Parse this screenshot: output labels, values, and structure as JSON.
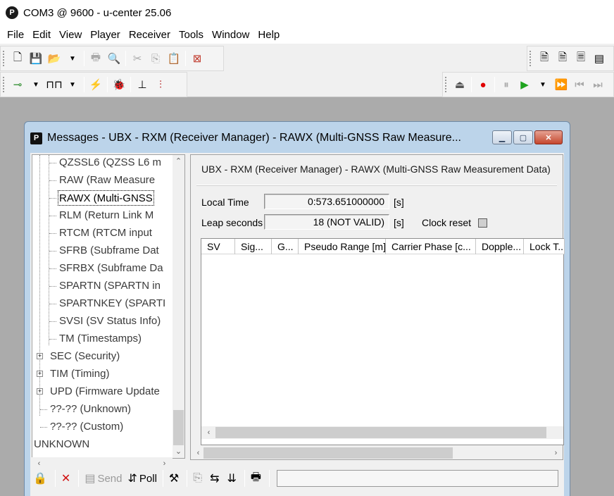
{
  "window": {
    "title": "COM3 @ 9600 - u-center 25.06",
    "icon_letter": "P"
  },
  "menu": [
    "File",
    "Edit",
    "View",
    "Player",
    "Receiver",
    "Tools",
    "Window",
    "Help"
  ],
  "child": {
    "title": "Messages - UBX - RXM (Receiver Manager) - RAWX (Multi-GNSS Raw Measure...",
    "icon_letter": "P"
  },
  "tree": {
    "items": [
      "QZSSL6 (QZSS L6 m",
      "RAW (Raw Measure",
      "RAWX (Multi-GNSS",
      "RLM (Return Link M",
      "RTCM (RTCM input",
      "SFRB (Subframe Dat",
      "SFRBX (Subframe Da",
      "SPARTN (SPARTN in",
      "SPARTNKEY (SPARTI",
      "SVSI (SV Status Info)",
      "TM (Timestamps)"
    ],
    "groups": [
      "SEC (Security)",
      "TIM (Timing)",
      "UPD (Firmware Update"
    ],
    "leaves": [
      "??-?? (Unknown)",
      "??-?? (Custom)"
    ],
    "root": "UNKNOWN",
    "selected_index": 2
  },
  "panel": {
    "heading": "UBX - RXM (Receiver Manager) - RAWX (Multi-GNSS Raw Measurement Data)",
    "local_time_label": "Local Time",
    "local_time_value": "0:573.651000000",
    "local_time_unit": "[s]",
    "leap_label": "Leap seconds",
    "leap_value": "18 (NOT VALID)",
    "leap_unit": "[s]",
    "clock_reset_label": "Clock reset"
  },
  "grid": {
    "columns": [
      "SV",
      "Sig...",
      "G...",
      "Pseudo Range [m]",
      "Carrier Phase [c...",
      "Dopple...",
      "Lock T..."
    ]
  },
  "bottom": {
    "send_label": "Send",
    "poll_label": "Poll"
  }
}
